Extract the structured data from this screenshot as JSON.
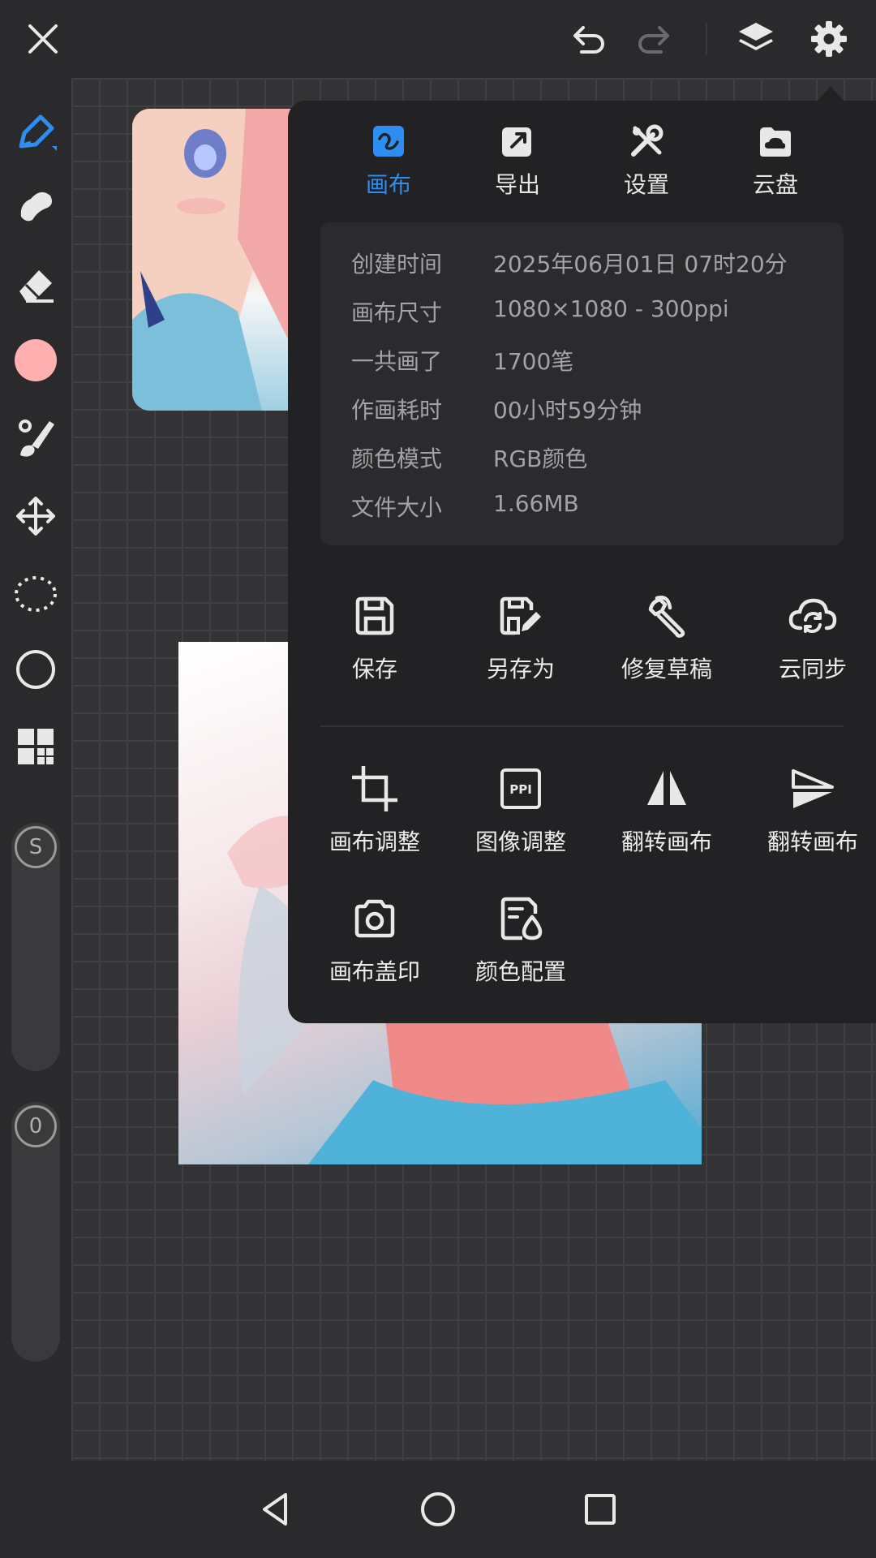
{
  "panel": {
    "tabs": [
      {
        "label": "画布",
        "icon": "canvas-icon",
        "active": true
      },
      {
        "label": "导出",
        "icon": "export-icon",
        "active": false
      },
      {
        "label": "设置",
        "icon": "settings-tools-icon",
        "active": false
      },
      {
        "label": "云盘",
        "icon": "cloud-drive-icon",
        "active": false
      }
    ],
    "info": [
      {
        "label": "创建时间",
        "value": "2025年06月01日 07时20分"
      },
      {
        "label": "画布尺寸",
        "value": "1080×1080 - 300ppi"
      },
      {
        "label": "一共画了",
        "value": "1700笔"
      },
      {
        "label": "作画耗时",
        "value": "00小时59分钟"
      },
      {
        "label": "颜色模式",
        "value": "RGB颜色"
      },
      {
        "label": "文件大小",
        "value": "1.66MB"
      }
    ],
    "actions_row1": [
      {
        "label": "保存",
        "icon": "save-icon"
      },
      {
        "label": "另存为",
        "icon": "save-as-icon"
      },
      {
        "label": "修复草稿",
        "icon": "wrench-icon"
      },
      {
        "label": "云同步",
        "icon": "cloud-sync-icon"
      }
    ],
    "actions_row2": [
      {
        "label": "画布调整",
        "icon": "crop-icon"
      },
      {
        "label": "图像调整",
        "icon": "ppi-icon"
      },
      {
        "label": "翻转画布",
        "icon": "flip-horizontal-icon"
      },
      {
        "label": "翻转画布",
        "icon": "flip-vertical-icon"
      }
    ],
    "actions_row3": [
      {
        "label": "画布盖印",
        "icon": "camera-icon"
      },
      {
        "label": "颜色配置",
        "icon": "color-profile-icon"
      }
    ]
  },
  "toolbar": {
    "size_slider_label": "S",
    "opacity_slider_label": "0",
    "current_color": "#ffb0b0"
  },
  "colors": {
    "accent": "#2d8ef0",
    "panel_bg": "#222224",
    "app_bg": "#2a2a2c"
  }
}
